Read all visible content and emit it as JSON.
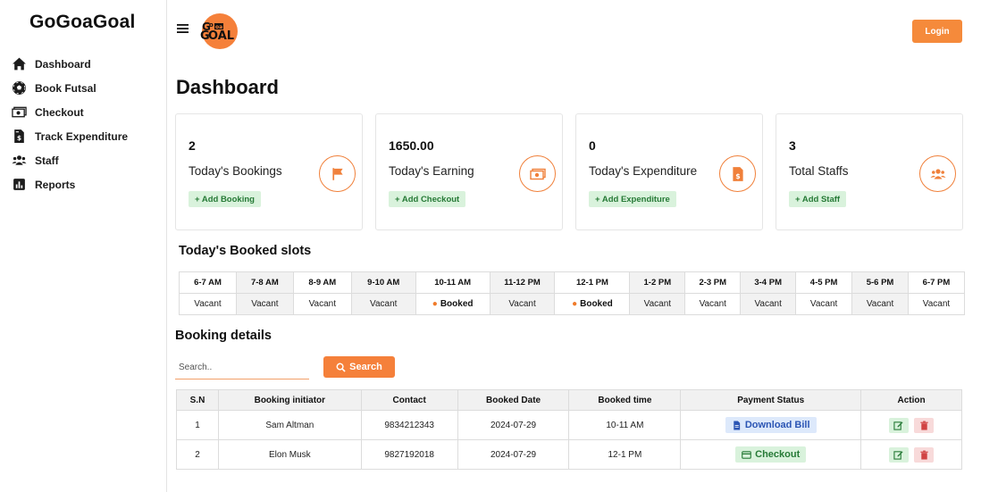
{
  "sidebar": {
    "brand": "GoGoaGoal",
    "items": [
      {
        "label": "Dashboard",
        "icon": "home-icon"
      },
      {
        "label": "Book Futsal",
        "icon": "soccer-ball-icon"
      },
      {
        "label": "Checkout",
        "icon": "money-bill-icon"
      },
      {
        "label": "Track Expenditure",
        "icon": "file-invoice-icon"
      },
      {
        "label": "Staff",
        "icon": "users-icon"
      },
      {
        "label": "Reports",
        "icon": "chart-icon"
      }
    ]
  },
  "header": {
    "logo_text": "GoGoaGoal",
    "login_label": "Login"
  },
  "page_title": "Dashboard",
  "cards": [
    {
      "value": "2",
      "label": "Today's Bookings",
      "button": "+ Add Booking",
      "icon": "flag-icon"
    },
    {
      "value": "1650.00",
      "label": "Today's Earning",
      "button": "+ Add Checkout",
      "icon": "money-bill-icon"
    },
    {
      "value": "0",
      "label": "Today's Expenditure",
      "button": "+ Add Expenditure",
      "icon": "file-invoice-icon"
    },
    {
      "value": "3",
      "label": "Total Staffs",
      "button": "+ Add Staff",
      "icon": "users-icon"
    }
  ],
  "slots": {
    "title": "Today's Booked slots",
    "times": [
      "6-7 AM",
      "7-8 AM",
      "8-9 AM",
      "9-10 AM",
      "10-11 AM",
      "11-12 PM",
      "12-1 PM",
      "1-2 PM",
      "2-3 PM",
      "3-4 PM",
      "4-5 PM",
      "5-6 PM",
      "6-7 PM"
    ],
    "statuses": [
      "Vacant",
      "Vacant",
      "Vacant",
      "Vacant",
      "Booked",
      "Vacant",
      "Booked",
      "Vacant",
      "Vacant",
      "Vacant",
      "Vacant",
      "Vacant",
      "Vacant"
    ]
  },
  "booking": {
    "title": "Booking details",
    "search_placeholder": "Search..",
    "search_label": "Search",
    "columns": [
      "S.N",
      "Booking initiator",
      "Contact",
      "Booked Date",
      "Booked time",
      "Payment Status",
      "Action"
    ],
    "rows": [
      {
        "sn": "1",
        "initiator": "Sam Altman",
        "contact": "9834212343",
        "date": "2024-07-29",
        "time": "10-11 AM",
        "payment": "Download Bill",
        "payment_type": "download"
      },
      {
        "sn": "2",
        "initiator": "Elon Musk",
        "contact": "9827192018",
        "date": "2024-07-29",
        "time": "12-1 PM",
        "payment": "Checkout",
        "payment_type": "checkout"
      }
    ]
  },
  "colors": {
    "accent": "#f5803a",
    "green_bg": "#d9f2dc",
    "green_text": "#267a36",
    "blue_bg": "#dde9fb",
    "blue_text": "#2b55b4"
  }
}
